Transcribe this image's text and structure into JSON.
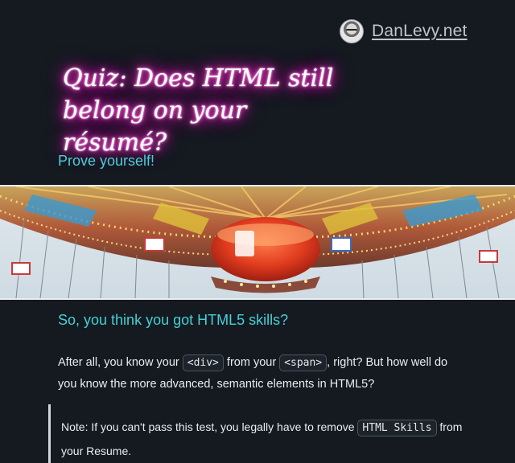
{
  "header": {
    "brand_name": "DanLevy.net",
    "avatar_icon": "avatar-icon"
  },
  "article": {
    "title": "Quiz: Does HTML still belong on your résumé?",
    "subtitle": "Prove yourself!",
    "hero_image_icon": "carousel-photo",
    "section_heading": "So, you think you got HTML5 skills?",
    "intro": {
      "text_1": "After all, you know your ",
      "code_1": "<div>",
      "text_2": " from your ",
      "code_2": "<span>",
      "text_3": ", right? But how well do you know the more advanced, semantic elements in HTML5?"
    },
    "note": {
      "text_1": "Note: If you can't pass this test, you legally have to remove ",
      "code": "HTML Skills",
      "text_2": " from your Resume."
    }
  },
  "colors": {
    "background": "#141a20",
    "accent": "#45d0d6",
    "neon": "#ff2bc9"
  }
}
